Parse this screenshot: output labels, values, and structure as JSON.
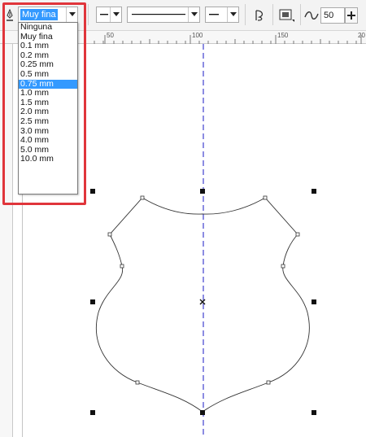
{
  "toolbar": {
    "outline_width": {
      "value": "Muy fina",
      "options": [
        "Ninguna",
        "Muy fina",
        "0.1 mm",
        "0.2 mm",
        "0.25 mm",
        "0.5 mm",
        "0.75 mm",
        "1.0 mm",
        "1.5 mm",
        "2.0 mm",
        "2.5 mm",
        "3.0 mm",
        "4.0 mm",
        "5.0 mm",
        "10.0 mm"
      ],
      "highlighted": "0.75 mm"
    },
    "smoothing_value": "50"
  },
  "ruler": {
    "ticks": [
      "50",
      "100",
      "150",
      "20"
    ]
  },
  "colors": {
    "accent_highlight": "#e0353b",
    "selection": "#3399ff",
    "guideline": "#5b5bd6"
  }
}
